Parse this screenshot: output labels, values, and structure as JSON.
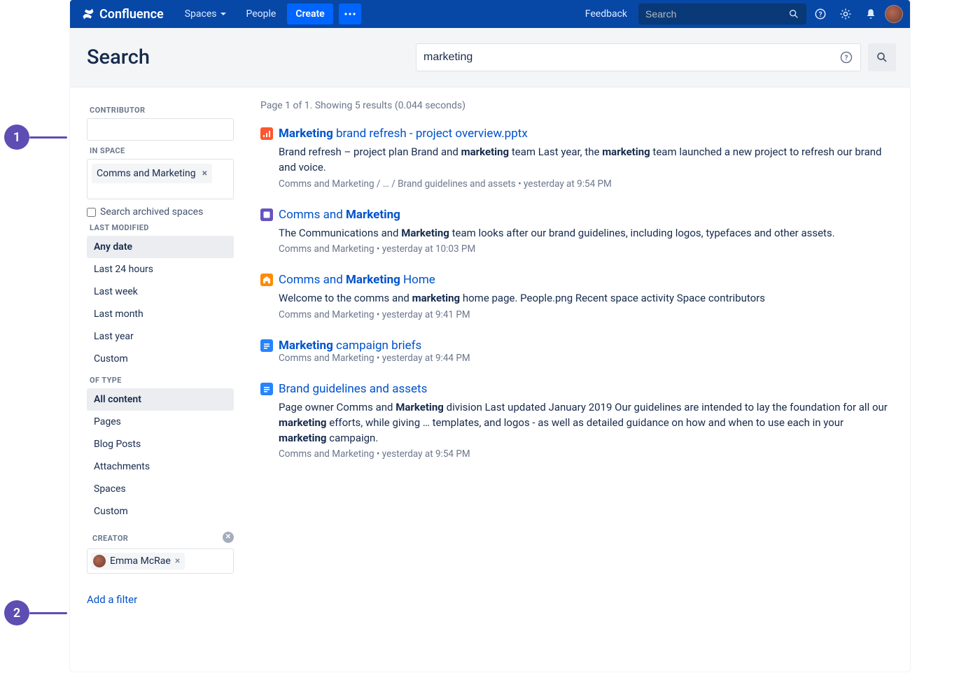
{
  "topnav": {
    "brand": "Confluence",
    "spaces": "Spaces",
    "people": "People",
    "create": "Create",
    "feedback": "Feedback",
    "search_placeholder": "Search"
  },
  "page": {
    "title": "Search",
    "query": "marketing"
  },
  "filters": {
    "contributor_label": "CONTRIBUTOR",
    "in_space_label": "IN SPACE",
    "space_chip": "Comms and Marketing",
    "archived_label": "Search archived spaces",
    "last_modified_label": "LAST MODIFIED",
    "last_modified_options": [
      "Any date",
      "Last 24 hours",
      "Last week",
      "Last month",
      "Last year",
      "Custom"
    ],
    "of_type_label": "OF TYPE",
    "of_type_options": [
      "All content",
      "Pages",
      "Blog Posts",
      "Attachments",
      "Spaces",
      "Custom"
    ],
    "creator_label": "CREATOR",
    "creator_name": "Emma McRae",
    "add_filter": "Add a filter"
  },
  "results_meta": "Page 1 of 1. Showing 5 results (0.044 seconds)",
  "results": [
    {
      "icon": "ppt",
      "title_html": "<b>Marketing</b> brand refresh - project overview.pptx",
      "snippet_html": "Brand refresh – project plan Brand and <b>marketing</b> team Last year, the <b>marketing</b> team launched a new project to refresh our brand and voice.",
      "path": "Comms and Marketing / … / Brand guidelines and assets • yesterday at 9:54 PM"
    },
    {
      "icon": "space",
      "title_html": "Comms and <b>Marketing</b>",
      "snippet_html": "The Communications and <b>Marketing</b> team looks after our brand guidelines, including logos, typefaces and other assets.",
      "path": "Comms and Marketing • yesterday at 10:03 PM"
    },
    {
      "icon": "home",
      "title_html": "Comms and <b>Marketing</b> Home",
      "snippet_html": "Welcome to the comms and <b>marketing</b> home page. People.png Recent space activity Space contributors",
      "path": "Comms and Marketing • yesterday at 9:41 PM"
    },
    {
      "icon": "page",
      "title_html": "<b>Marketing</b> campaign briefs",
      "snippet_html": "",
      "path": "Comms and Marketing • yesterday at 9:44 PM"
    },
    {
      "icon": "page",
      "title_html": "Brand guidelines and assets",
      "snippet_html": "Page owner Comms and <b>Marketing</b> division Last updated January 2019 Our guidelines are intended to lay the foundation for all our <b>marketing</b> efforts, while giving … templates, and logos - as well as detailed guidance on how and when to use each in your <b>marketing</b> campaign.",
      "path": "Comms and Marketing • yesterday at 9:54 PM"
    }
  ],
  "callouts": [
    "1",
    "2"
  ]
}
